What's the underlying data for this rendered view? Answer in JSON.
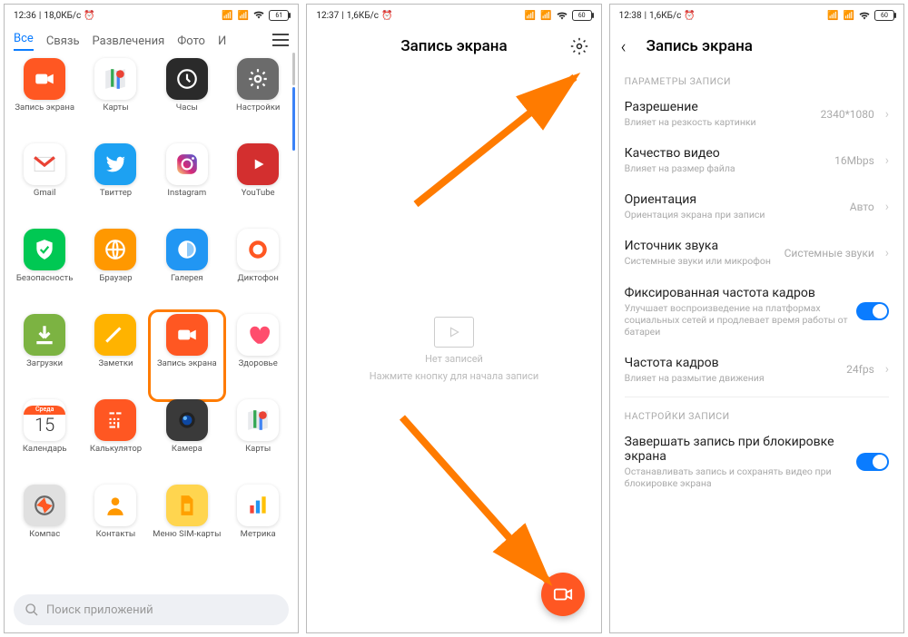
{
  "p1": {
    "status": {
      "time": "12:36",
      "net": "18,0КБ/с",
      "batt": "61"
    },
    "tabs": [
      "Все",
      "Связь",
      "Развлечения",
      "Фото",
      "И"
    ],
    "apps": [
      {
        "n": "Запись экрана",
        "c": "#ff5722",
        "ic": "cam"
      },
      {
        "n": "Карты",
        "c": "#fff",
        "ic": "gmaps"
      },
      {
        "n": "Часы",
        "c": "#2a2a2a",
        "ic": "clock"
      },
      {
        "n": "Настройки",
        "c": "#6b6b6b",
        "ic": "gear"
      },
      {
        "n": "Gmail",
        "c": "#fff",
        "ic": "gmail"
      },
      {
        "n": "Твиттер",
        "c": "#1da1f2",
        "ic": "tw"
      },
      {
        "n": "Instagram",
        "c": "#fff",
        "ic": "ig"
      },
      {
        "n": "YouTube",
        "c": "#d32f2f",
        "ic": "yt"
      },
      {
        "n": "Безопасность",
        "c": "#00c853",
        "ic": "shield"
      },
      {
        "n": "Браузер",
        "c": "#ff9800",
        "ic": "globe"
      },
      {
        "n": "Галерея",
        "c": "#2196f3",
        "ic": "gal"
      },
      {
        "n": "Диктофон",
        "c": "#fff",
        "ic": "rec"
      },
      {
        "n": "Загрузки",
        "c": "#7cb342",
        "ic": "dl"
      },
      {
        "n": "Заметки",
        "c": "#ffb300",
        "ic": "note"
      },
      {
        "n": "Запись экрана",
        "c": "#ff5722",
        "ic": "cam",
        "hl": true
      },
      {
        "n": "Здоровье",
        "c": "#fff",
        "ic": "heart"
      },
      {
        "n": "Календарь",
        "c": "#fff",
        "ic": "cal",
        "d": "Среда",
        "dn": "15"
      },
      {
        "n": "Калькулятор",
        "c": "#ff5722",
        "ic": "calc"
      },
      {
        "n": "Камера",
        "c": "#3a3a3a",
        "ic": "lens"
      },
      {
        "n": "Карты",
        "c": "#fff",
        "ic": "gmaps"
      },
      {
        "n": "Компас",
        "c": "#e0e0e0",
        "ic": "comp"
      },
      {
        "n": "Контакты",
        "c": "#fff",
        "ic": "con"
      },
      {
        "n": "Меню SIM-карты",
        "c": "#ffd54f",
        "ic": "sim"
      },
      {
        "n": "Метрика",
        "c": "#fff",
        "ic": "bars"
      }
    ],
    "search": "Поиск приложений"
  },
  "p2": {
    "status": {
      "time": "12:37",
      "net": "1,6КБ/с",
      "batt": "60"
    },
    "title": "Запись экрана",
    "empty1": "Нет записей",
    "empty2": "Нажмите кнопку для начала записи"
  },
  "p3": {
    "status": {
      "time": "12:38",
      "net": "1,6КБ/с",
      "batt": "60"
    },
    "title": "Запись экрана",
    "sect1": "ПАРАМЕТРЫ ЗАПИСИ",
    "rows": [
      {
        "t": "Разрешение",
        "s": "Влияет на резкость картинки",
        "v": "2340*1080",
        "k": "c"
      },
      {
        "t": "Качество видео",
        "s": "Влияет на размер файла",
        "v": "16Mbps",
        "k": "c"
      },
      {
        "t": "Ориентация",
        "s": "Ориентация экрана при записи",
        "v": "Авто",
        "k": "c"
      },
      {
        "t": "Источник звука",
        "s": "Системные звуки или микрофон",
        "v": "Системные звуки",
        "k": "c"
      },
      {
        "t": "Фиксированная частота кадров",
        "s": "Улучшает воспроизведение на платформах социальных сетей и продлевает время работы от батареи",
        "v": "",
        "k": "t"
      },
      {
        "t": "Частота кадров",
        "s": "Влияет на размытие движения",
        "v": "24fps",
        "k": "c"
      }
    ],
    "sect2": "НАСТРОЙКИ ЗАПИСИ",
    "rows2": [
      {
        "t": "Завершать запись при блокировке экрана",
        "s": "Останавливать запись и сохранять видео при блокировке экрана",
        "v": "",
        "k": "t"
      }
    ]
  }
}
